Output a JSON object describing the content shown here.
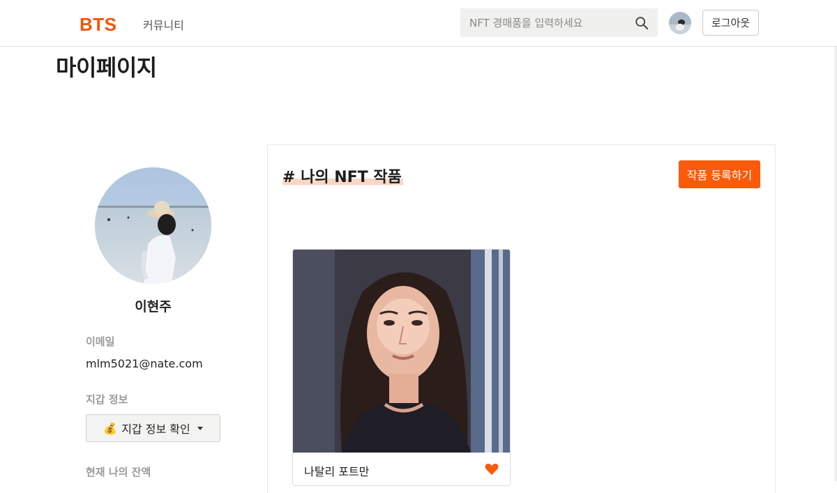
{
  "header": {
    "logo": "BTS",
    "nav_community": "커뮤니티",
    "search_placeholder": "NFT 경매품을 입력하세요",
    "logout_label": "로그아웃",
    "brand_color": "#f2530c"
  },
  "page": {
    "title": "마이페이지"
  },
  "profile": {
    "name": "이현주",
    "email_label": "이메일",
    "email_value": "mlm5021@nate.com",
    "wallet_label": "지갑 정보",
    "wallet_button_icon": "💰",
    "wallet_button_label": "지갑 정보 확인",
    "balance_label": "현재 나의 잔액"
  },
  "main": {
    "section_title": "# 나의 NFT 작품",
    "register_button_label": "작품 등록하기",
    "accent_color": "#fa5a0a",
    "nfts": [
      {
        "title": "나탈리 포트만",
        "liked": true,
        "image_icon": "portrait-photo"
      }
    ]
  }
}
